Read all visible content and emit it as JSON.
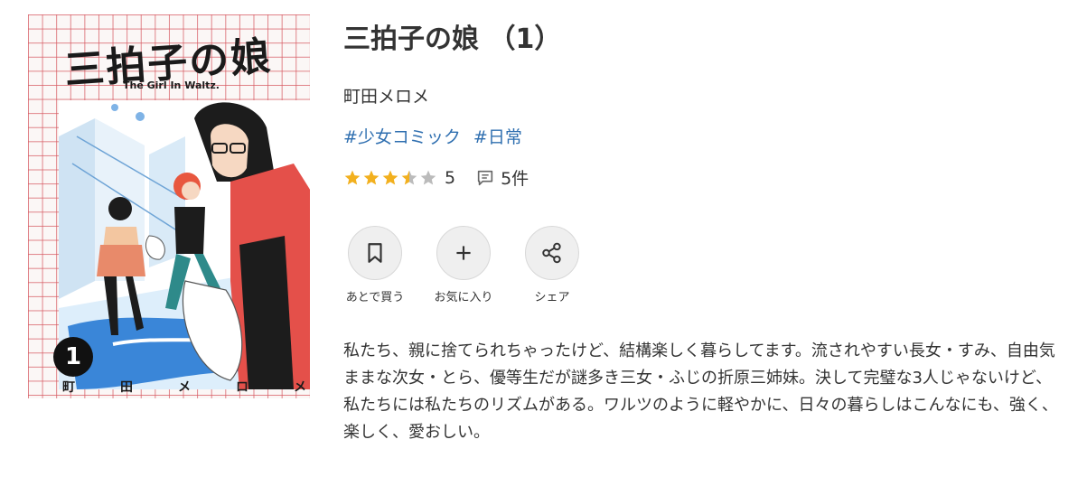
{
  "cover": {
    "title_art": "三拍子の娘",
    "subtitle_art": "The Girl In Waltz.",
    "volume_art": "1",
    "author_art": [
      "町",
      "田",
      "メ",
      "ロ",
      "メ"
    ]
  },
  "book": {
    "title": "三拍子の娘 （1）",
    "author": "町田メロメ",
    "tags": [
      "#少女コミック",
      "#日常"
    ]
  },
  "rating": {
    "stars": 3.5,
    "max": 5,
    "value": "5",
    "reviews": "5件",
    "star_color": "#f2b01e",
    "star_empty_color": "#bbbbbb"
  },
  "actions": [
    {
      "label": "あとで買う",
      "icon": "bookmark-icon"
    },
    {
      "label": "お気に入り",
      "icon": "plus-icon"
    },
    {
      "label": "シェア",
      "icon": "share-icon"
    }
  ],
  "description": "私たち、親に捨てられちゃったけど、結構楽しく暮らしてます。流されやすい長女・すみ、自由気ままな次女・とら、優等生だが謎多き三女・ふじの折原三姉妹。決して完璧な3人じゃないけど、私たちには私たちのリズムがある。ワルツのように軽やかに、日々の暮らしはこんなにも、強く、楽しく、愛おしい。",
  "colors": {
    "tag": "#2f6fb0",
    "text": "#333333",
    "cover_grid": "#d65860"
  }
}
